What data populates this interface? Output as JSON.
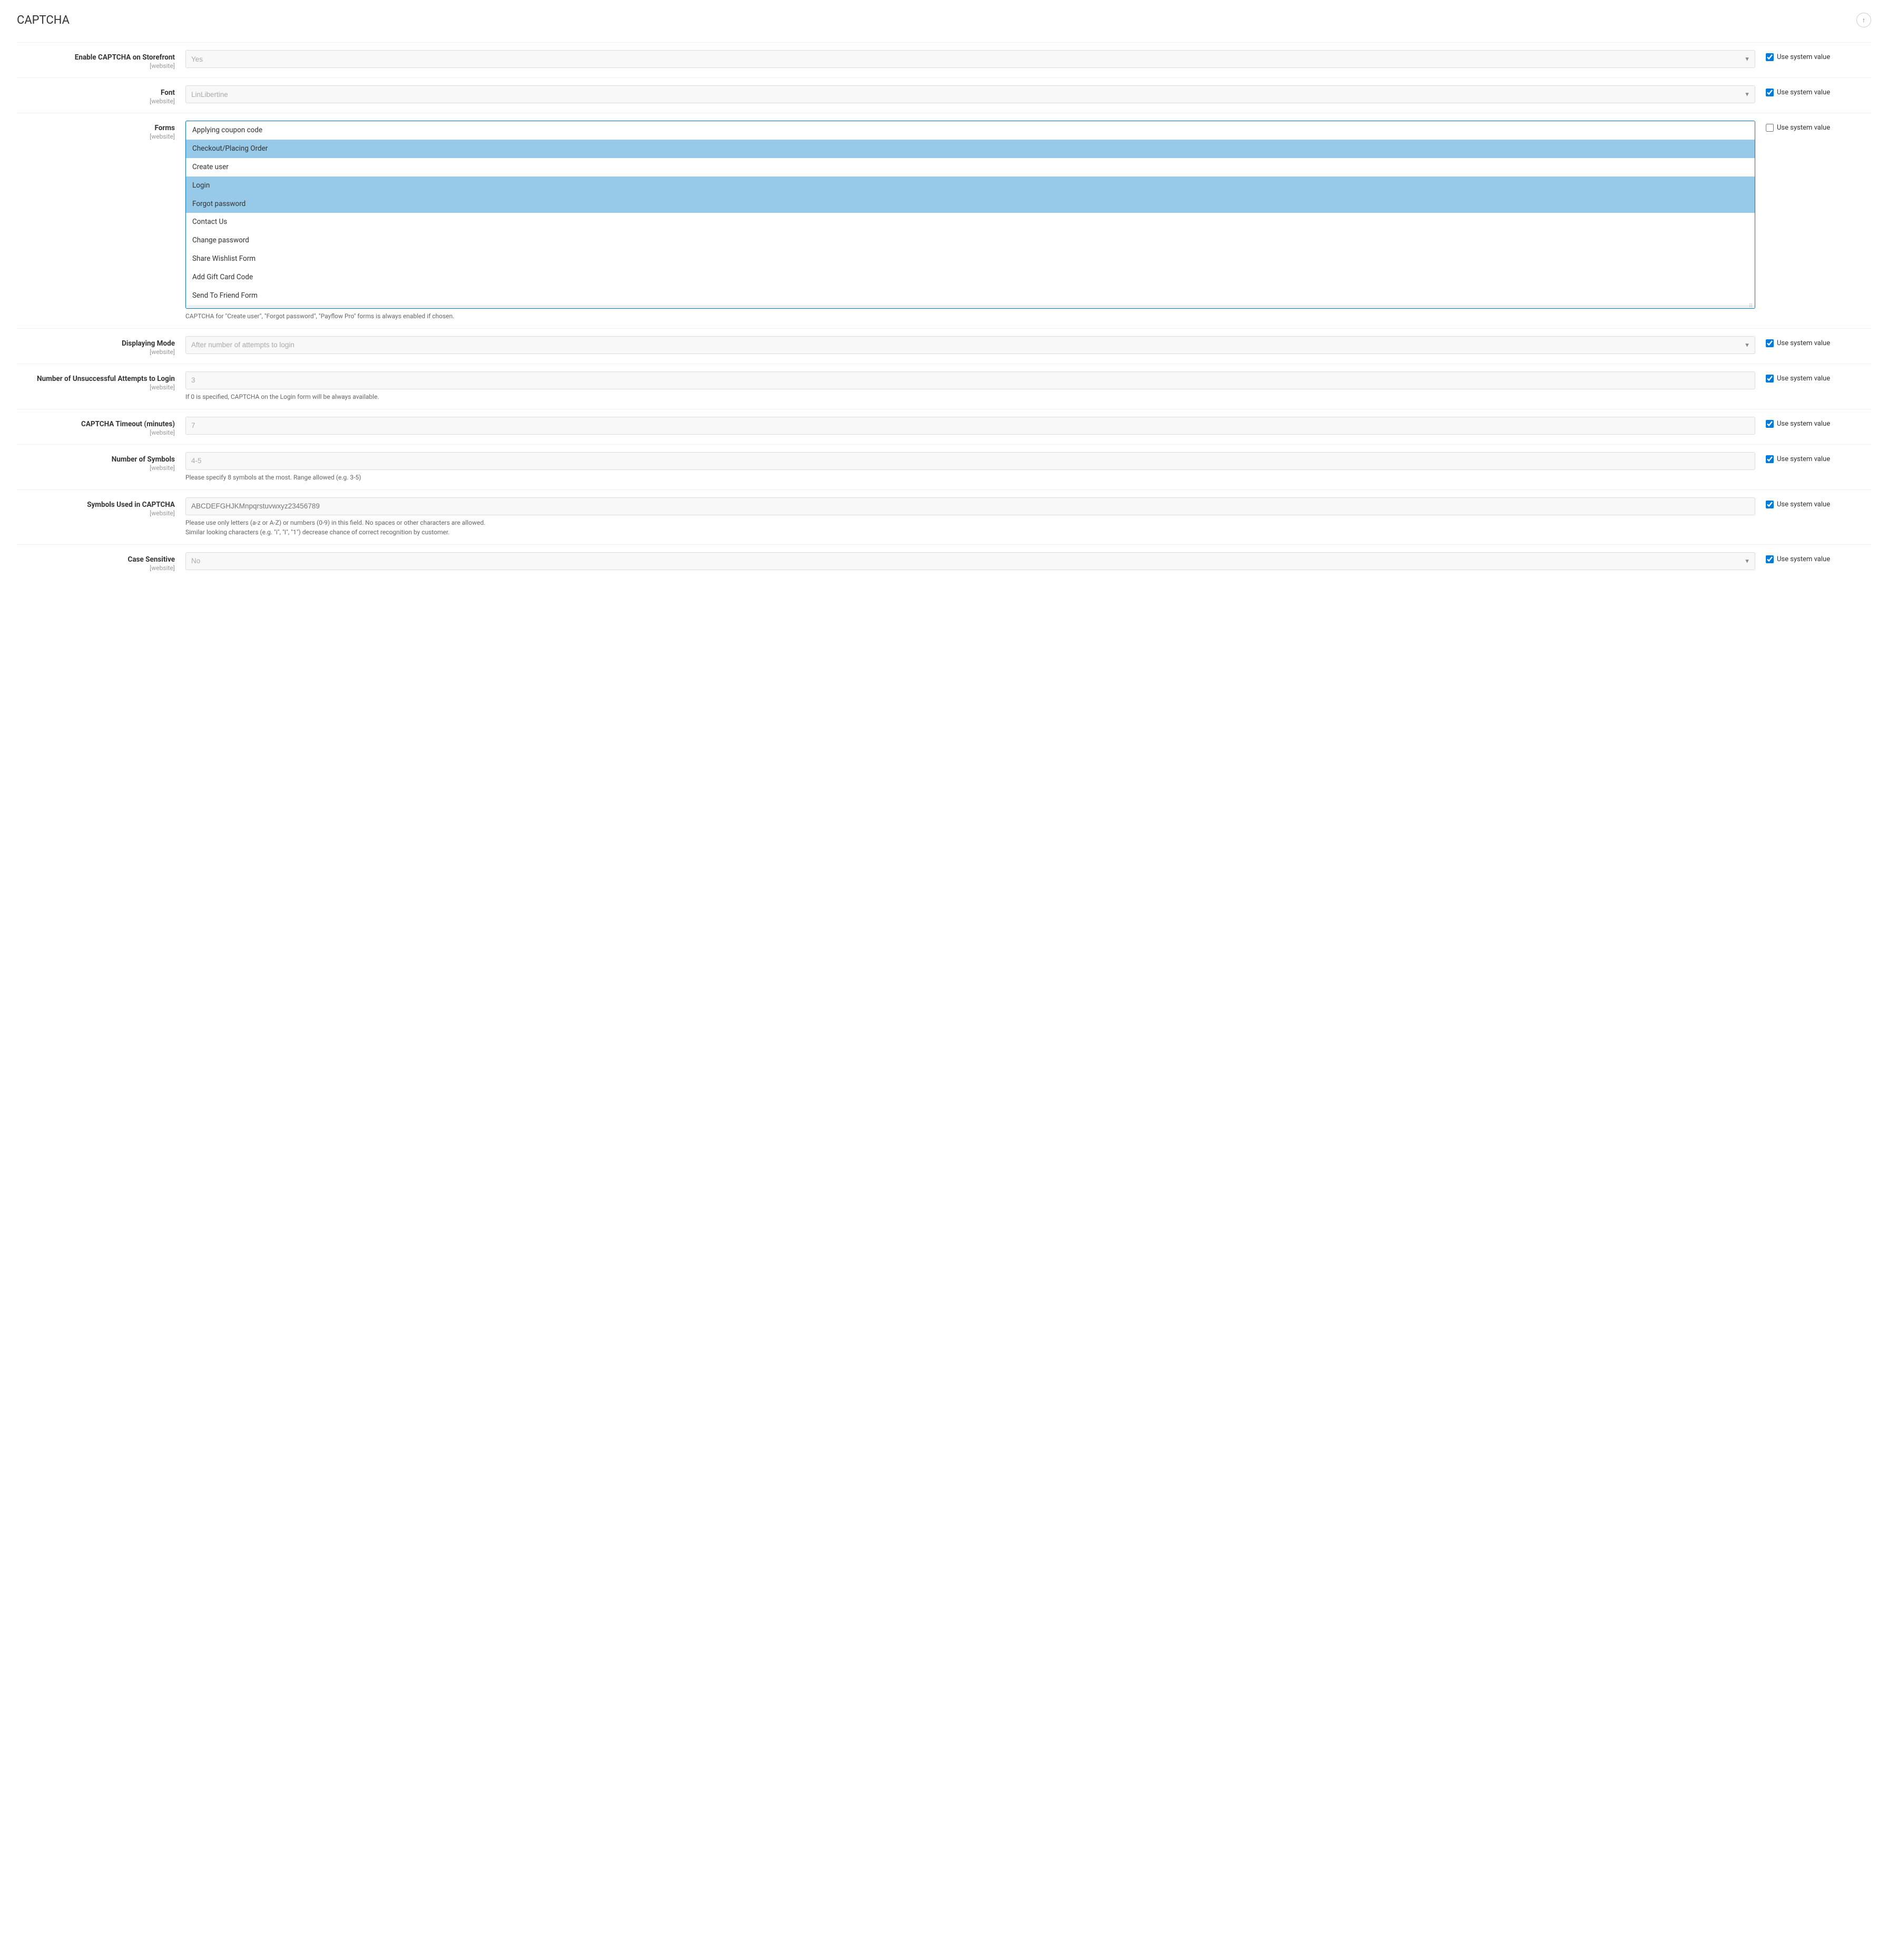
{
  "page": {
    "title": "CAPTCHA",
    "collapse_icon": "↑"
  },
  "fields": {
    "enable_captcha": {
      "label": "Enable CAPTCHA on Storefront",
      "scope": "[website]",
      "value": "Yes",
      "use_system_value": true,
      "use_system_label": "Use system value"
    },
    "font": {
      "label": "Font",
      "scope": "[website]",
      "value": "LinLibertine",
      "use_system_value": true,
      "use_system_label": "Use system value"
    },
    "forms": {
      "label": "Forms",
      "scope": "[website]",
      "use_system_value": false,
      "use_system_label": "Use system value",
      "hint": "CAPTCHA for \"Create user\", \"Forgot password\", \"Payflow Pro\" forms is always enabled if chosen.",
      "options": [
        {
          "label": "Applying coupon code",
          "selected": false
        },
        {
          "label": "Checkout/Placing Order",
          "selected": true
        },
        {
          "label": "Create user",
          "selected": false
        },
        {
          "label": "Login",
          "selected": true
        },
        {
          "label": "Forgot password",
          "selected": true
        },
        {
          "label": "Contact Us",
          "selected": false
        },
        {
          "label": "Change password",
          "selected": false
        },
        {
          "label": "Share Wishlist Form",
          "selected": false
        },
        {
          "label": "Add Gift Card Code",
          "selected": false
        },
        {
          "label": "Send To Friend Form",
          "selected": false
        }
      ]
    },
    "displaying_mode": {
      "label": "Displaying Mode",
      "scope": "[website]",
      "value": "After number of attempts to login",
      "use_system_value": true,
      "use_system_label": "Use system value"
    },
    "unsuccessful_attempts": {
      "label": "Number of Unsuccessful Attempts to Login",
      "scope": "[website]",
      "value": "3",
      "hint": "If 0 is specified, CAPTCHA on the Login form will be always available.",
      "use_system_value": true,
      "use_system_label": "Use system value"
    },
    "captcha_timeout": {
      "label": "CAPTCHA Timeout (minutes)",
      "scope": "[website]",
      "value": "7",
      "use_system_value": true,
      "use_system_label": "Use system value"
    },
    "number_of_symbols": {
      "label": "Number of Symbols",
      "scope": "[website]",
      "value": "4-5",
      "hint": "Please specify 8 symbols at the most. Range allowed (e.g. 3-5)",
      "use_system_value": true,
      "use_system_label": "Use system value"
    },
    "symbols_used": {
      "label": "Symbols Used in CAPTCHA",
      "scope": "[website]",
      "placeholder": "ABCDEFGHJKMnpqrstuvwxyz23456789",
      "hint1": "Please use only letters (a-z or A-Z) or numbers (0-9) in this field. No spaces or other characters are allowed.",
      "hint2": "Similar looking characters (e.g. \"i\", \"I\", \"1\") decrease chance of correct recognition by customer.",
      "use_system_value": true,
      "use_system_label": "Use system value"
    },
    "case_sensitive": {
      "label": "Case Sensitive",
      "scope": "[website]",
      "value": "No",
      "use_system_value": true,
      "use_system_label": "Use system value"
    }
  }
}
